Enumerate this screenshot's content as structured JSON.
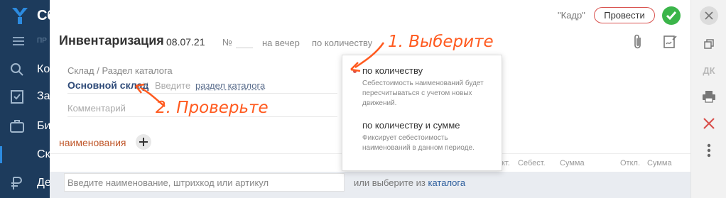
{
  "nav": {
    "logo_text": "Сб",
    "section_label": "ПР",
    "items": [
      {
        "label": "Ко",
        "icon": "contacts-icon"
      },
      {
        "label": "За",
        "icon": "tasks-icon"
      },
      {
        "label": "Би",
        "icon": "briefcase-icon"
      },
      {
        "label": "Де",
        "icon": "money-icon"
      }
    ],
    "sub_active": "Ск"
  },
  "header": {
    "author": "\"Кадр\"",
    "post_label": "Провести",
    "title": "Инвентаризация",
    "date": "08.07.21",
    "number_sign": "№",
    "time_label": "на вечер",
    "method_label": "по количеству"
  },
  "form": {
    "warehouse_label": "Склад / Раздел каталога",
    "warehouse_value": "Основной склад",
    "remove_glyph": "×",
    "enter_prefix": "Введите",
    "catalog_section_link": "раздел каталога",
    "comment_placeholder": "Комментарий"
  },
  "items_section": {
    "title": "наименования",
    "columns": [
      "кт.",
      "Себест.",
      "Сумма",
      "Откл.",
      "Сумма"
    ]
  },
  "bottom": {
    "search_placeholder": "Введите наименование, штрихкод или артикул",
    "or_text": "или выберите из",
    "catalog_link": "каталога"
  },
  "dropdown": {
    "options": [
      {
        "title": "по количеству",
        "desc": "Себестоимость наименований будет пересчитываться с учетом новых движений.",
        "selected": true
      },
      {
        "title": "по количеству и сумме",
        "desc": "Фиксирует себестоимость наименований в данном периоде.",
        "selected": false
      }
    ]
  },
  "right_panel": {
    "dk_label": "ДК"
  },
  "annotations": {
    "step1": "1. Выберите",
    "step2": "2. Проверьте"
  },
  "colors": {
    "nav_bg": "#1d3b5c",
    "accent_red": "#d9534f",
    "ok_green": "#3bb54a",
    "annotation_orange": "#ff5a1f"
  }
}
